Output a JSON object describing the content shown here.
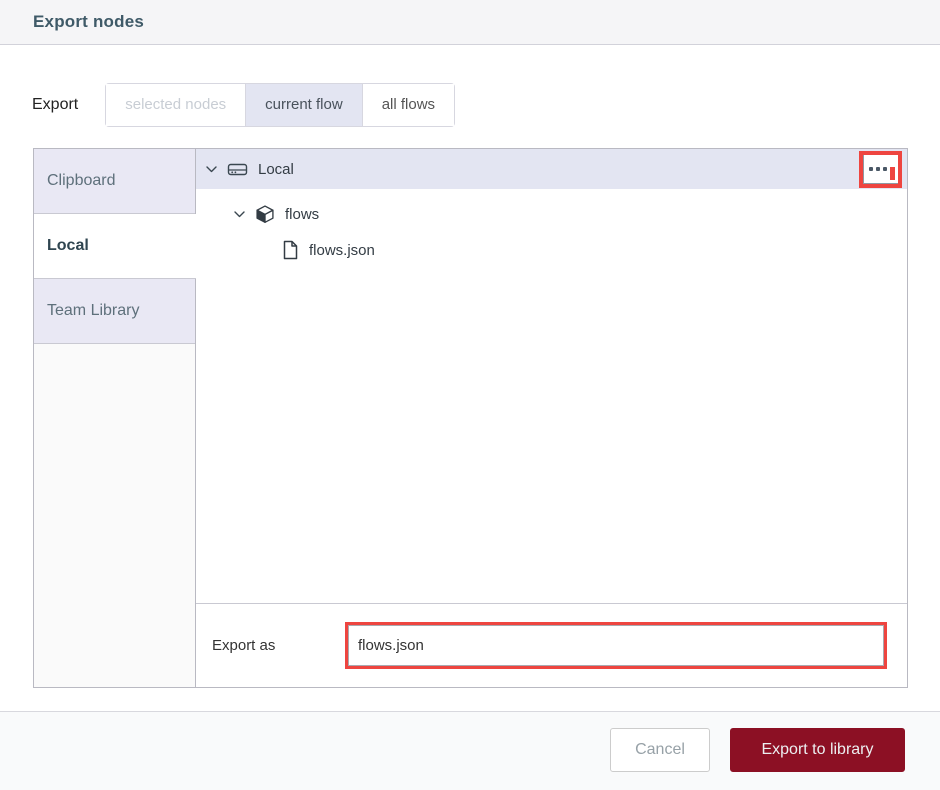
{
  "dialog": {
    "title": "Export nodes",
    "scope": {
      "label": "Export",
      "tabs": [
        {
          "label": "selected nodes",
          "state": "disabled"
        },
        {
          "label": "current flow",
          "state": "selected"
        },
        {
          "label": "all flows",
          "state": "normal"
        }
      ]
    },
    "library_tabs": [
      {
        "label": "Clipboard",
        "state": "normal"
      },
      {
        "label": "Local",
        "state": "selected"
      },
      {
        "label": "Team Library",
        "state": "normal"
      }
    ],
    "tree": [
      {
        "label": "Local",
        "icon": "hard-drive-icon",
        "depth": 0,
        "expanded": true,
        "selected": true
      },
      {
        "label": "flows",
        "icon": "cube-icon",
        "depth": 1,
        "expanded": true,
        "selected": false
      },
      {
        "label": "flows.json",
        "icon": "file-icon",
        "depth": 2,
        "expanded": false,
        "selected": false
      }
    ],
    "menu_button": {
      "icon": "ellipsis-icon",
      "annotated": true
    },
    "export_as": {
      "label": "Export as",
      "value": "flows.json",
      "annotated": true
    },
    "footer": {
      "cancel_label": "Cancel",
      "submit_label": "Export to library"
    }
  },
  "colors": {
    "annotation_red": "#ee4540",
    "primary_button": "#8c1024",
    "selection_lavender": "#e3e5f2",
    "sidebar_tab": "#e9e8f4",
    "header_bg": "#f5f5f7",
    "header_text": "#3f5a68",
    "footer_bg": "#f9fafb"
  }
}
